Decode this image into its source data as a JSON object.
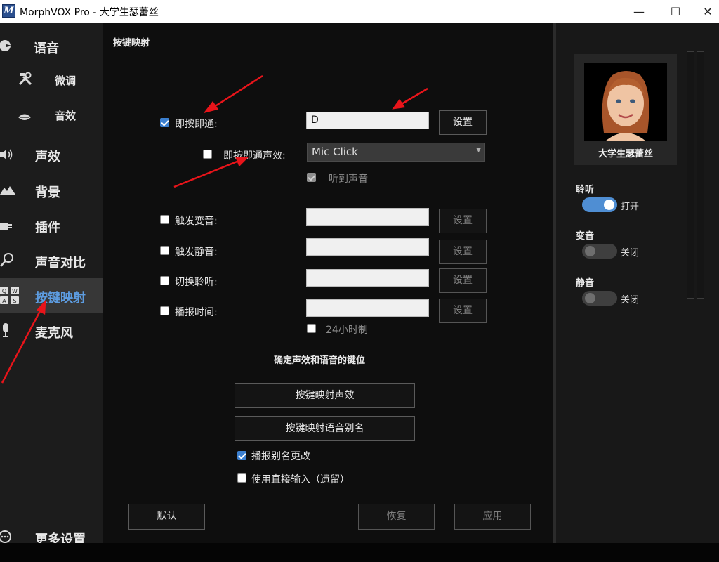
{
  "window": {
    "title": "MorphVOX Pro - 大学生瑟蕾丝",
    "app_icon": "M",
    "controls": {
      "minimize": "—",
      "maximize": "☐",
      "close": "✕"
    }
  },
  "sidebar": {
    "items": [
      {
        "icon": "voice-icon",
        "label": "语音"
      },
      {
        "icon": "tools-icon",
        "label": "微调"
      },
      {
        "icon": "lips-icon",
        "label": "音效"
      },
      {
        "icon": "speaker-icon",
        "label": "声效"
      },
      {
        "icon": "background-icon",
        "label": "背景"
      },
      {
        "icon": "plugin-icon",
        "label": "插件"
      },
      {
        "icon": "magnifier-icon",
        "label": "声音对比"
      },
      {
        "icon": "keyboard-keys-icon",
        "label": "按键映射",
        "active": true,
        "keycaps": [
          "Q",
          "W",
          "A",
          "S"
        ]
      },
      {
        "icon": "microphone-icon",
        "label": "麦克风"
      },
      {
        "icon": "more-icon",
        "label": "更多设置"
      }
    ]
  },
  "main": {
    "section_title": "按键映射",
    "push_to_talk": {
      "label": "即按即通:",
      "checked": true,
      "key_value": "D",
      "set_button": "设置"
    },
    "ptt_sound": {
      "label": "即按即通声效:",
      "checked": false,
      "selected": "Mic Click"
    },
    "hear_sound": {
      "label": "听到声音",
      "checked": true,
      "disabled": true
    },
    "bindings": [
      {
        "label": "触发变音:",
        "checked": false,
        "value": "",
        "button": "设置"
      },
      {
        "label": "触发静音:",
        "checked": false,
        "value": "",
        "button": "设置"
      },
      {
        "label": "切换聆听:",
        "checked": false,
        "value": "",
        "button": "设置"
      },
      {
        "label": "播报时间:",
        "checked": false,
        "value": "",
        "button": "设置"
      }
    ],
    "clock_24h": {
      "label": "24小时制",
      "checked": false
    },
    "voice_keys_heading": "确定声效和语音的键位",
    "map_sound_button": "按键映射声效",
    "map_alias_button": "按键映射语音别名",
    "announce_alias": {
      "label": "播报别名更改",
      "checked": true
    },
    "direct_input": {
      "label": "使用直接输入（遗留）",
      "checked": false
    },
    "footer": {
      "default": "默认",
      "restore": "恢复",
      "apply": "应用"
    }
  },
  "right_panel": {
    "voice_name": "大学生瑟蕾丝",
    "listen": {
      "label": "聆听",
      "state": "打开",
      "on": true
    },
    "morph": {
      "label": "变音",
      "state": "关闭",
      "on": false
    },
    "mute": {
      "label": "静音",
      "state": "关闭",
      "on": false
    }
  },
  "colors": {
    "accent": "#3b7fcf",
    "active_nav_text": "#5d9ce0",
    "annotation_arrow": "#e8141a"
  }
}
